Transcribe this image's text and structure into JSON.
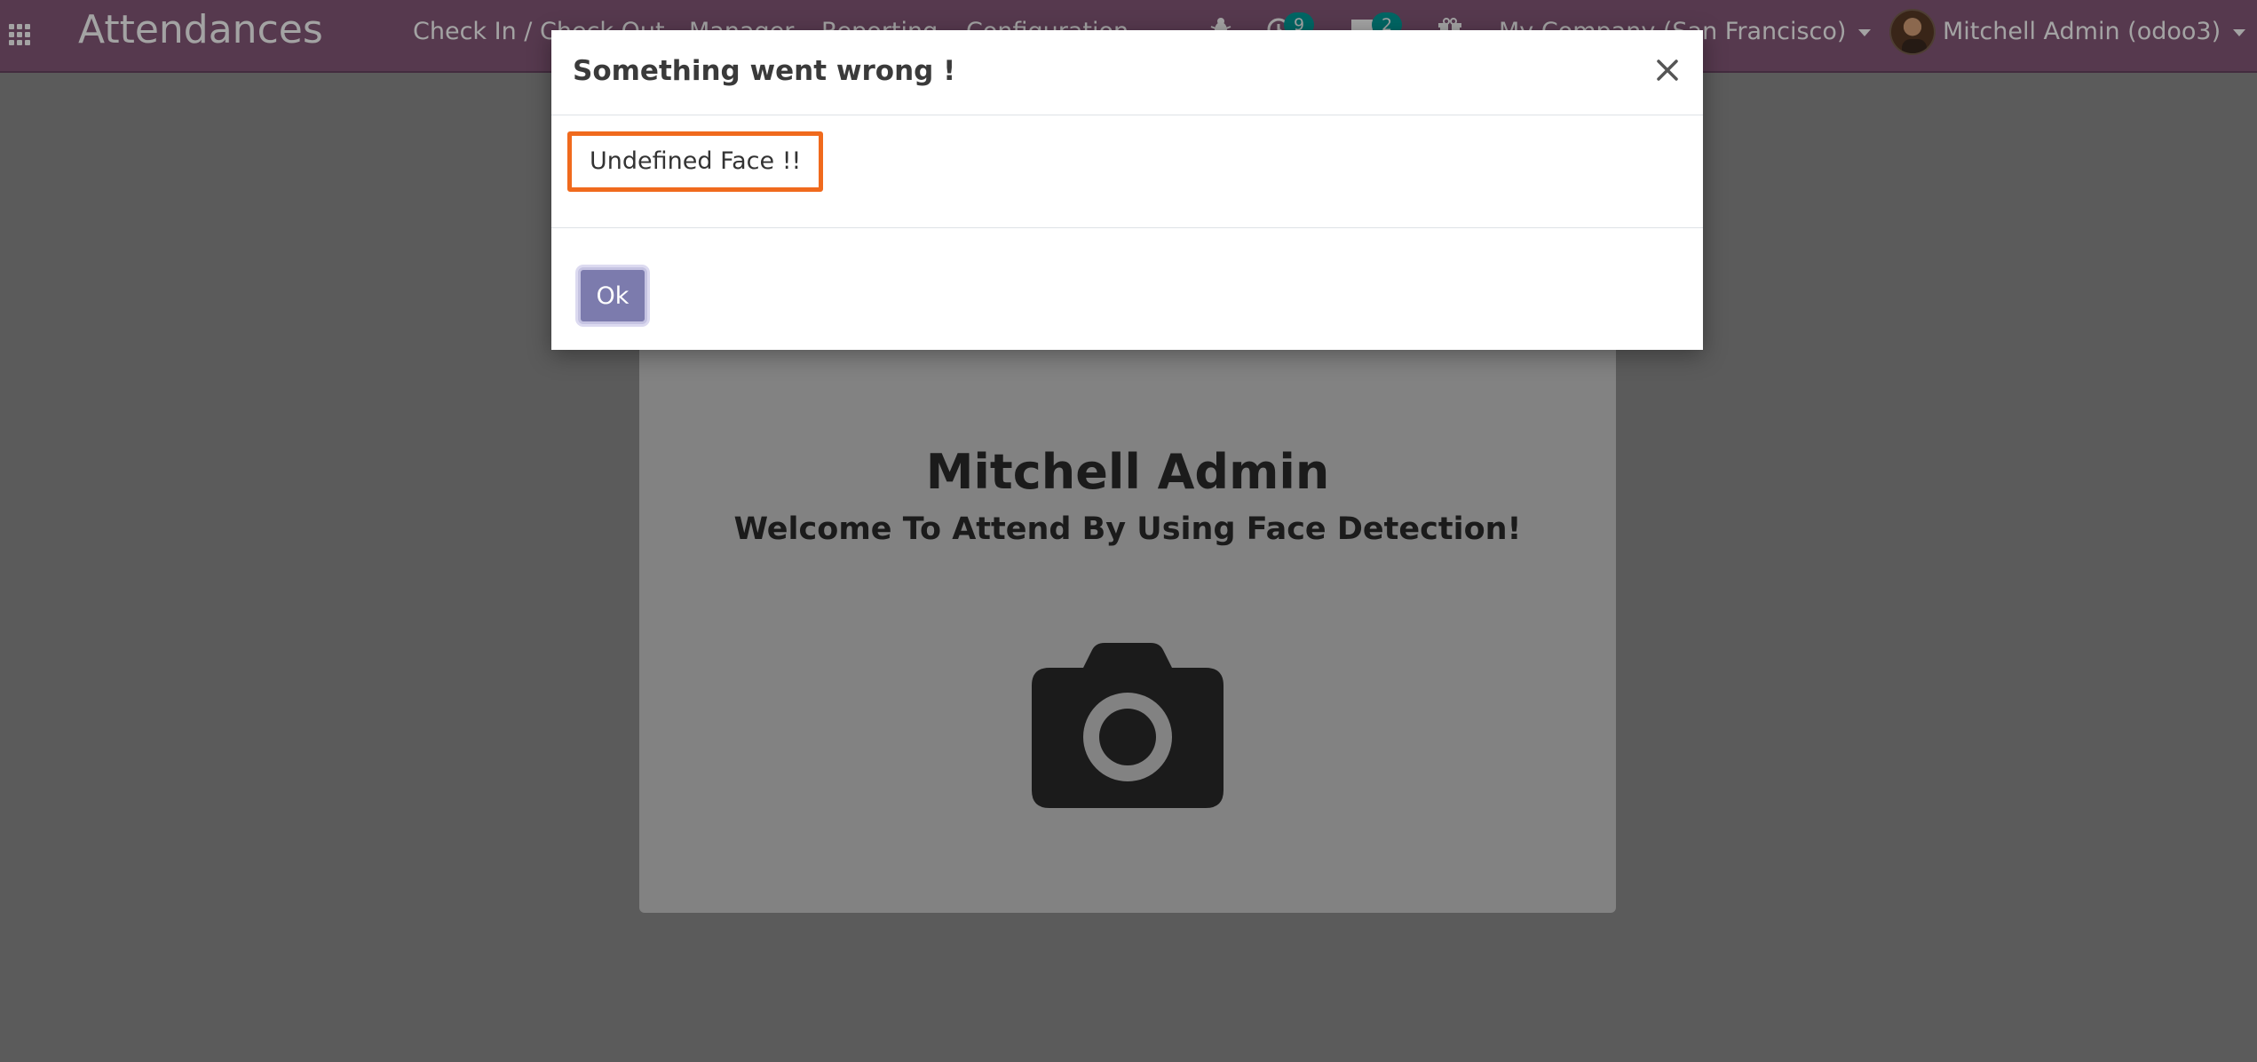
{
  "navbar": {
    "brand": "Attendances",
    "menu": [
      "Check In / Check Out",
      "Manager",
      "Reporting",
      "Configuration"
    ],
    "activity_count": "9",
    "message_count": "2",
    "company": "My Company (San Francisco)",
    "user": "Mitchell Admin (odoo3)"
  },
  "kiosk": {
    "employee_name": "Mitchell Admin",
    "welcome": "Welcome To Attend By Using Face Detection!"
  },
  "dialog": {
    "title": "Something went wrong !",
    "message": "Undefined Face !!",
    "ok_label": "Ok"
  },
  "icons": {
    "apps": "grid-icon",
    "debug": "bug-icon",
    "activity": "clock-icon",
    "messages": "chat-icon",
    "gift": "gift-icon",
    "camera": "camera-icon",
    "close": "close-icon"
  },
  "colors": {
    "navbar": "#875a7b",
    "badge": "#00a09d",
    "primary_button": "#7c7bad",
    "highlight_border": "#f06a1d"
  }
}
